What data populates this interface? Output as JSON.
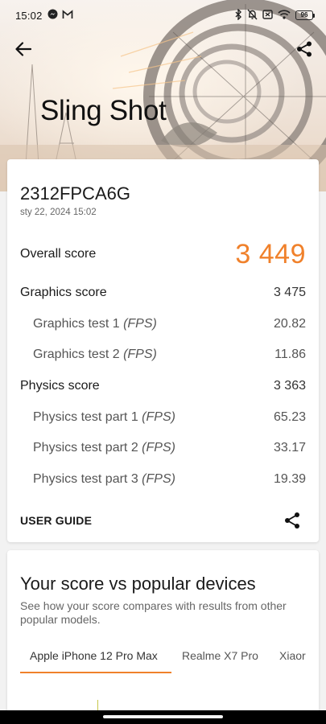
{
  "status_bar": {
    "time": "15:02",
    "left_icons": [
      "messenger-icon",
      "gmail-icon"
    ],
    "right_icons": [
      "bluetooth-icon",
      "bell-off-icon",
      "no-sim-icon",
      "wifi-icon"
    ],
    "battery": "96"
  },
  "header": {
    "title": "Sling Shot"
  },
  "result": {
    "device_name": "2312FPCA6G",
    "timestamp": "sty 22, 2024 15:02",
    "overall_label": "Overall score",
    "overall_value": "3 449",
    "graphics_label": "Graphics score",
    "graphics_value": "3 475",
    "graphics_tests": [
      {
        "label": "Graphics test 1",
        "unit": "(FPS)",
        "value": "20.82"
      },
      {
        "label": "Graphics test 2",
        "unit": "(FPS)",
        "value": "11.86"
      }
    ],
    "physics_label": "Physics score",
    "physics_value": "3 363",
    "physics_tests": [
      {
        "label": "Physics test part 1",
        "unit": "(FPS)",
        "value": "65.23"
      },
      {
        "label": "Physics test part 2",
        "unit": "(FPS)",
        "value": "33.17"
      },
      {
        "label": "Physics test part 3",
        "unit": "(FPS)",
        "value": "19.39"
      }
    ],
    "user_guide_label": "USER GUIDE"
  },
  "compare": {
    "title": "Your score vs popular devices",
    "description": "See how your score compares with results from other popular models.",
    "tabs": [
      "Apple iPhone 12 Pro Max",
      "Realme X7 Pro",
      "Xiaor"
    ],
    "active_tab": 0
  },
  "colors": {
    "accent": "#f0812b",
    "background": "#f2f2f2",
    "card": "#ffffff"
  }
}
